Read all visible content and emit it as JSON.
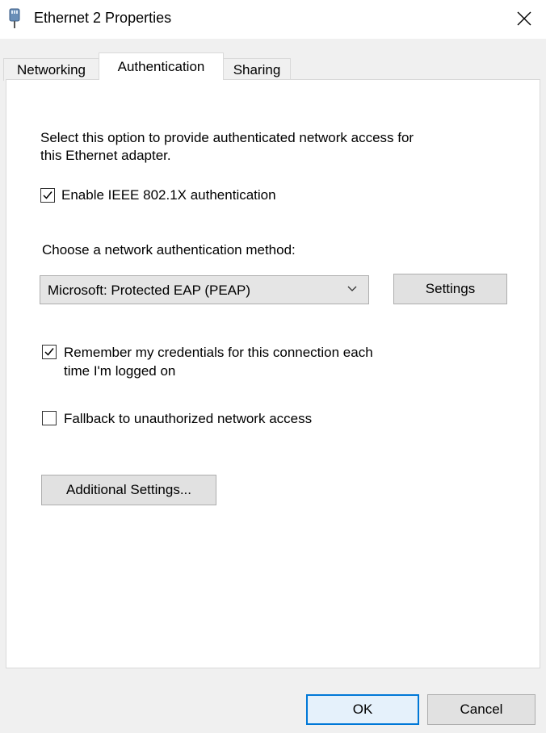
{
  "window": {
    "title": "Ethernet 2 Properties",
    "icon": "network-adapter-icon"
  },
  "tabs": [
    {
      "label": "Networking",
      "active": false
    },
    {
      "label": "Authentication",
      "active": true
    },
    {
      "label": "Sharing",
      "active": false
    }
  ],
  "auth": {
    "description_line1": "Select this option to provide authenticated network access for",
    "description_line2": "this Ethernet adapter.",
    "enable_label": "Enable IEEE 802.1X authentication",
    "enable_checked": true,
    "method_label": "Choose a network authentication method:",
    "method_value": "Microsoft: Protected EAP (PEAP)",
    "settings_button": "Settings",
    "remember_line1": "Remember my credentials for this connection each",
    "remember_line2": "time I'm logged on",
    "remember_checked": true,
    "fallback_label": "Fallback to unauthorized network access",
    "fallback_checked": false,
    "additional_button": "Additional Settings..."
  },
  "footer": {
    "ok_label": "OK",
    "cancel_label": "Cancel"
  },
  "colors": {
    "accent": "#0078d7",
    "dialog_bg": "#f0f0f0",
    "button_bg": "#e1e1e1"
  }
}
